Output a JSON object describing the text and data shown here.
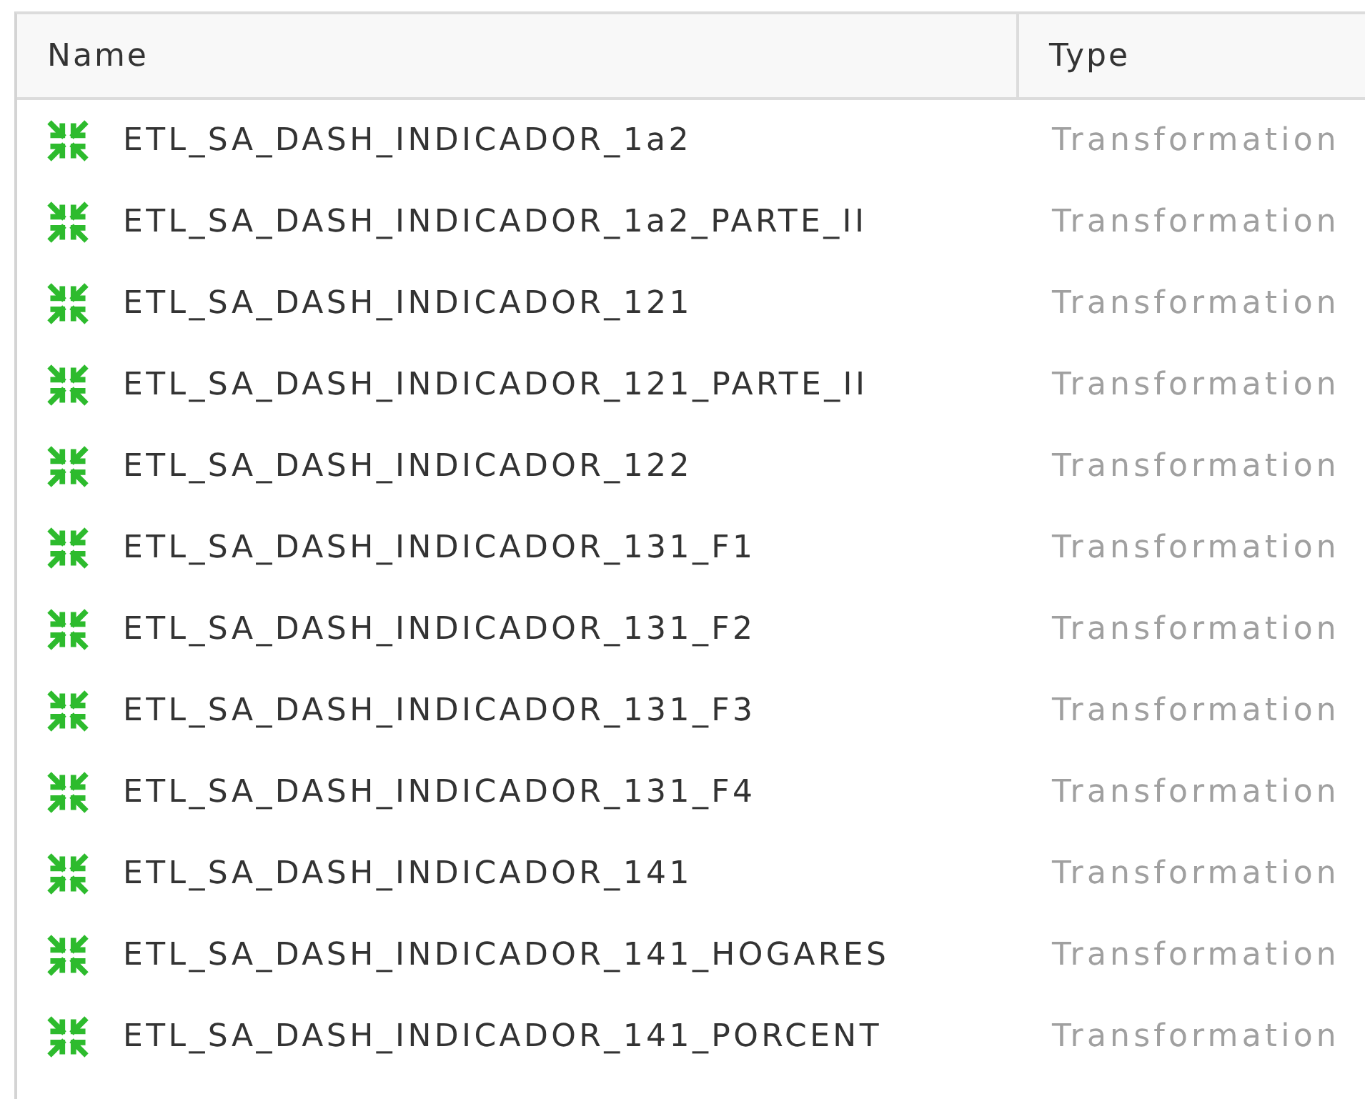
{
  "table": {
    "columns": [
      "Name",
      "Type"
    ],
    "rows": [
      {
        "name": "ETL_SA_DASH_INDICADOR_1a2",
        "type": "Transformation"
      },
      {
        "name": "ETL_SA_DASH_INDICADOR_1a2_PARTE_II",
        "type": "Transformation"
      },
      {
        "name": "ETL_SA_DASH_INDICADOR_121",
        "type": "Transformation"
      },
      {
        "name": "ETL_SA_DASH_INDICADOR_121_PARTE_II",
        "type": "Transformation"
      },
      {
        "name": "ETL_SA_DASH_INDICADOR_122",
        "type": "Transformation"
      },
      {
        "name": "ETL_SA_DASH_INDICADOR_131_F1",
        "type": "Transformation"
      },
      {
        "name": "ETL_SA_DASH_INDICADOR_131_F2",
        "type": "Transformation"
      },
      {
        "name": "ETL_SA_DASH_INDICADOR_131_F3",
        "type": "Transformation"
      },
      {
        "name": "ETL_SA_DASH_INDICADOR_131_F4",
        "type": "Transformation"
      },
      {
        "name": "ETL_SA_DASH_INDICADOR_141",
        "type": "Transformation"
      },
      {
        "name": "ETL_SA_DASH_INDICADOR_141_HOGARES",
        "type": "Transformation"
      },
      {
        "name": "ETL_SA_DASH_INDICADOR_141_PORCENT",
        "type": "Transformation"
      }
    ]
  }
}
